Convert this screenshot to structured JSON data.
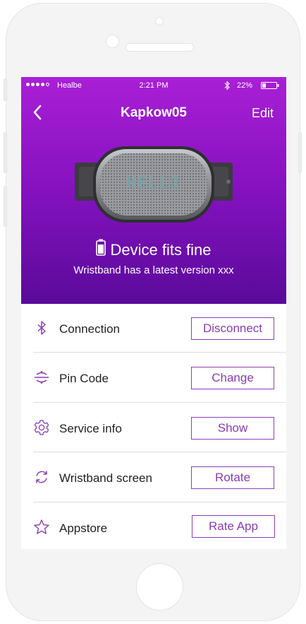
{
  "status_bar": {
    "carrier": "Healbe",
    "time": "2:21 PM",
    "battery": "22%"
  },
  "nav": {
    "title": "Kapkow05",
    "edit_label": "Edit"
  },
  "device": {
    "display_text": "HELLO",
    "fit_status": "Device fits fine",
    "version_note": "Wristband has a latest version xxx"
  },
  "settings": [
    {
      "label": "Connection",
      "icon": "bluetooth-icon",
      "button": "Disconnect"
    },
    {
      "label": "Pin Code",
      "icon": "pin-code-icon",
      "button": "Change"
    },
    {
      "label": "Service info",
      "icon": "gear-icon",
      "button": "Show"
    },
    {
      "label": "Wristband screen",
      "icon": "rotate-icon",
      "button": "Rotate"
    },
    {
      "label": "Appstore",
      "icon": "star-icon",
      "button": "Rate App"
    }
  ],
  "colors": {
    "accent": "#8a3cb3",
    "header_top": "#a91fd6",
    "header_bottom": "#5a0a9a"
  }
}
